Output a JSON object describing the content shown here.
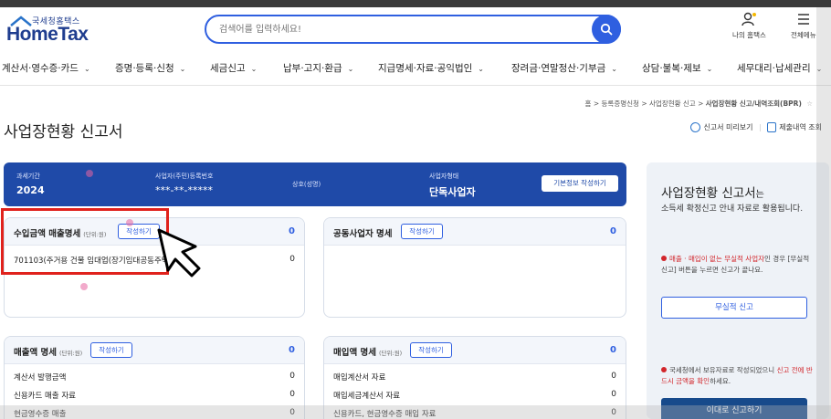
{
  "header": {
    "logo_small": "국세청홈택스",
    "logo_main": "HomeTax",
    "search_placeholder": "검색어를 입력하세요!",
    "my_hometax": "나의 홈택스",
    "all_menu": "전체메뉴"
  },
  "nav": {
    "items": [
      {
        "label": "계산서·영수증·카드"
      },
      {
        "label": "증명·등록·신청"
      },
      {
        "label": "세금신고"
      },
      {
        "label": "납부·고지·환급"
      },
      {
        "label": "지급명세·자료·공익법인"
      },
      {
        "label": "장려금·연말정산·기부금"
      },
      {
        "label": "상담·불복·제보"
      },
      {
        "label": "세무대리·납세관리"
      }
    ]
  },
  "breadcrumb": {
    "items": [
      "홈",
      "등록증명신청",
      "사업장현황 신고",
      "사업장현황 신고/내역조회(BPR)"
    ],
    "separator": ">"
  },
  "page": {
    "title": "사업장현황 신고서",
    "preview_label": "신고서 미리보기",
    "history_label": "제출내역 조회"
  },
  "summary_bar": {
    "period_label": "과세기간",
    "period_value": "2024",
    "reg_label": "사업자(주민)등록번호",
    "reg_value": "***-**-*****",
    "name_label": "상호(성명)",
    "type_label": "사업자형태",
    "type_value": "단독사업자",
    "basic_info_button": "기본정보 작성하기"
  },
  "panels": {
    "income": {
      "title": "수입금액 매출명세",
      "unit": "(단위:원)",
      "write": "작성하기",
      "total": "0",
      "rows": [
        {
          "label": "701103(주거용 건물 임대업(장기임대공동주택))",
          "value": "0"
        }
      ]
    },
    "partners": {
      "title": "공동사업자 명세",
      "write": "작성하기",
      "total": "0"
    },
    "sales": {
      "title": "매출액 명세",
      "unit": "(단위:원)",
      "write": "작성하기",
      "total": "0",
      "rows": [
        {
          "label": "계산서 발행금액",
          "value": "0"
        },
        {
          "label": "신용카드 매출 자료",
          "value": "0"
        },
        {
          "label": "현금영수증 매출",
          "value": "0"
        }
      ]
    },
    "purchases": {
      "title": "매입액 명세",
      "unit": "(단위:원)",
      "write": "작성하기",
      "total": "0",
      "rows": [
        {
          "label": "매입계산서 자료",
          "value": "0"
        },
        {
          "label": "매입세금계산서 자료",
          "value": "0"
        },
        {
          "label": "신용카드, 현금영수증 매입 자료",
          "value": "0"
        }
      ]
    }
  },
  "sidebar": {
    "title": "사업장현황 신고서",
    "title_suffix": "는",
    "desc": "소득세 확정신고 안내 자료로 활용됩니다.",
    "note1_red": "매출 · 매입이 없는 무실적 사업자",
    "note1_rest": "인 경우 [무실적 신고] 버튼을 누르면 신고가 끝나요.",
    "no_activity_button": "무실적 신고",
    "note2_plain": "국세청에서 보유자료로 작성되었으니",
    "note2_red": "신고 전에 반드시 금액을 확인",
    "note2_end": "하세요.",
    "submit_button": "이대로 신고하기"
  },
  "colors": {
    "brand_blue": "#1f4aa8",
    "accent_blue": "#2f5fe0",
    "highlight_red": "#e0221c",
    "dark_button": "#174a8b"
  }
}
